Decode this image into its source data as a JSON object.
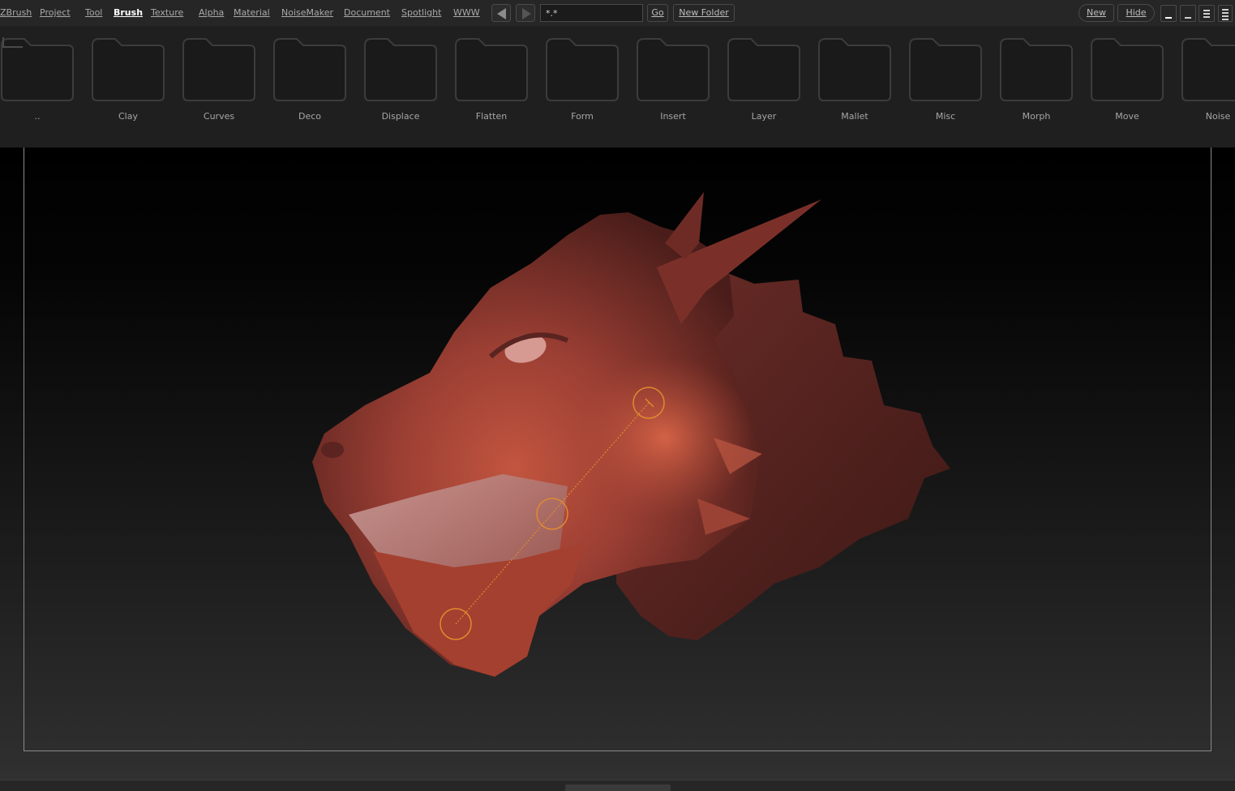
{
  "menu": {
    "items": [
      "ZBrush",
      "Project",
      "Tool",
      "Brush",
      "Texture",
      "Alpha",
      "Material",
      "NoiseMaker",
      "Document",
      "Spotlight",
      "WWW"
    ],
    "active": "Brush"
  },
  "toolbar": {
    "filter_value": "*.*",
    "go_label": "Go",
    "new_folder_label": "New Folder",
    "new_label": "New",
    "hide_label": "Hide"
  },
  "folders": [
    "..",
    "Clay",
    "Curves",
    "Deco",
    "Displace",
    "Flatten",
    "Form",
    "Insert",
    "Layer",
    "Mallet",
    "Misc",
    "Morph",
    "Move",
    "Noise"
  ],
  "icons": {
    "back": "left-arrow-icon",
    "forward": "right-arrow-icon",
    "folder": "folder-icon",
    "parent": "up-level-icon"
  },
  "colors": {
    "accent": "#ffffff",
    "stroke_line": "#e08a30",
    "model": "#a0443a"
  }
}
